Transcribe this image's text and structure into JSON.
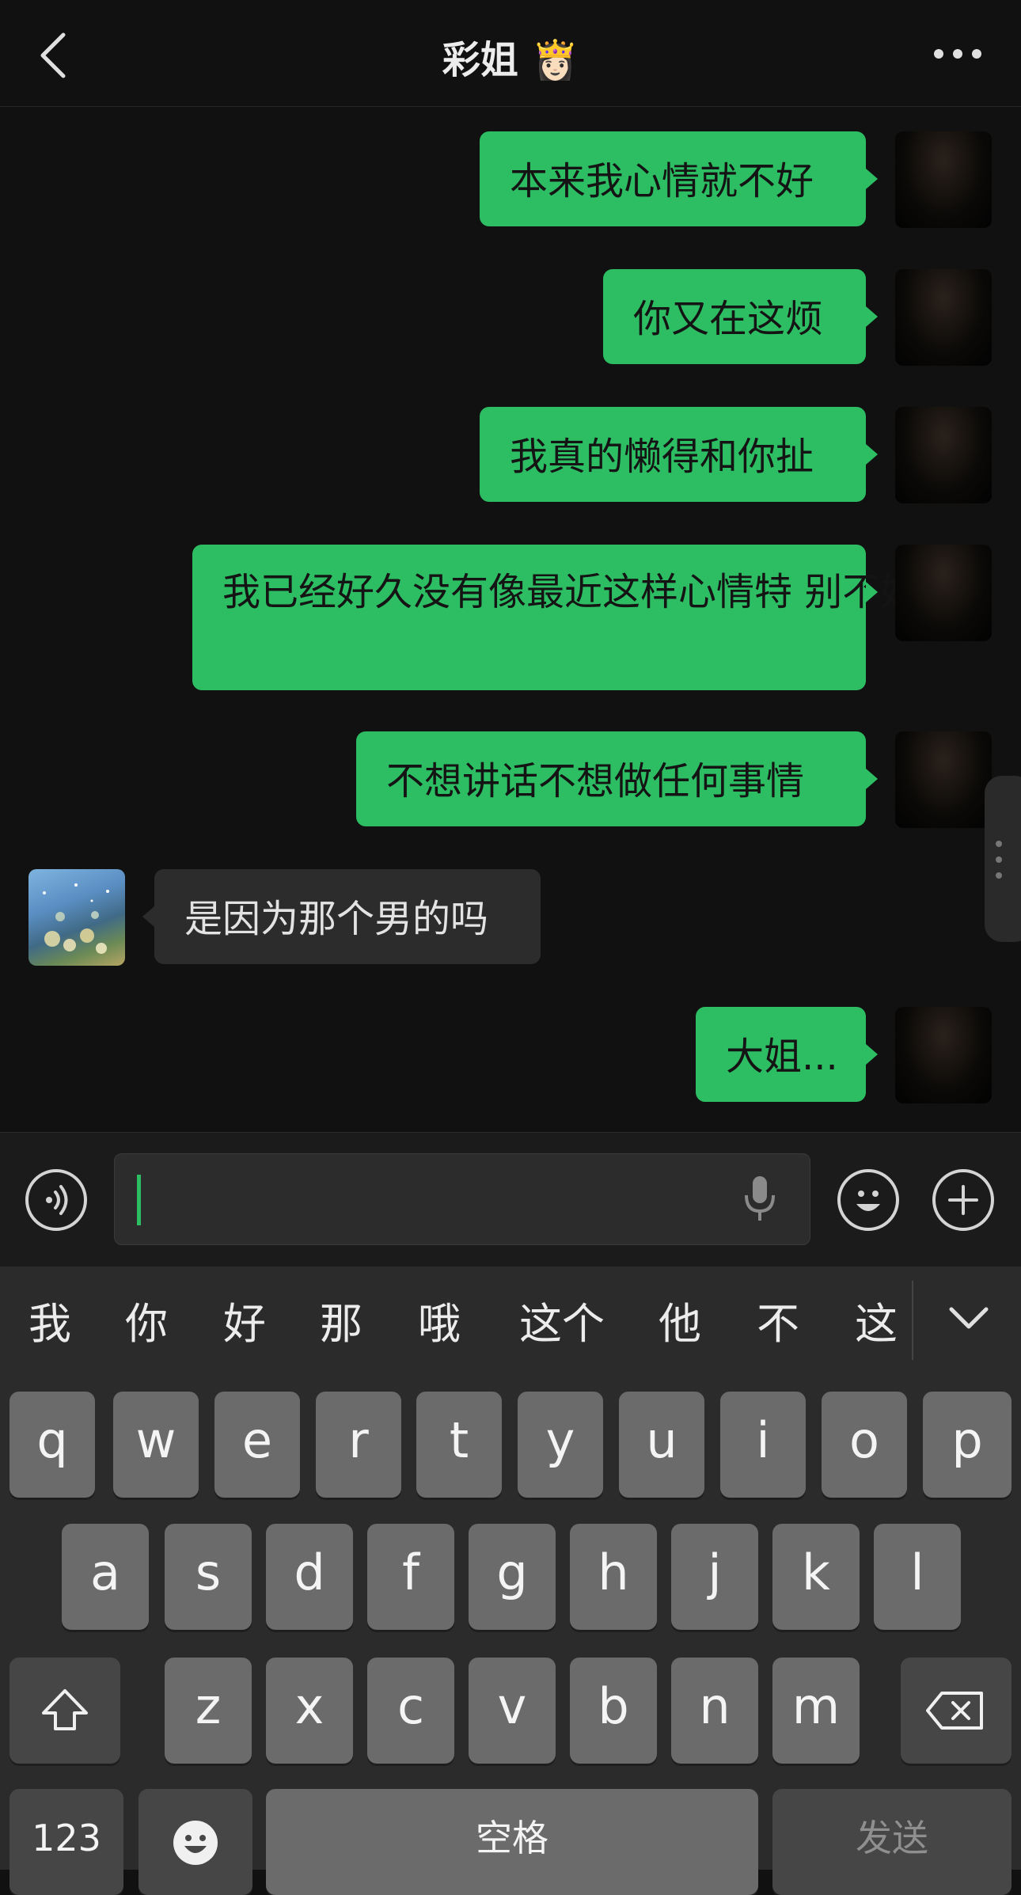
{
  "header": {
    "title": "彩姐 👸🏻"
  },
  "messages": [
    {
      "side": "me",
      "text": "本来我心情就不好"
    },
    {
      "side": "me",
      "text": "你又在这烦"
    },
    {
      "side": "me",
      "text": "我真的懒得和你扯"
    },
    {
      "side": "me",
      "text_line1": "我已经好久没有像最近这样心情特",
      "text_line2": "别不好了"
    },
    {
      "side": "me",
      "text": "不想讲话不想做任何事情"
    },
    {
      "side": "them",
      "text": "是因为那个男的吗"
    },
    {
      "side": "me",
      "text": "大姐..."
    }
  ],
  "input": {
    "voice_icon": "voice-wave-icon",
    "mic_icon": "microphone-icon",
    "emoji_icon": "smiley-icon",
    "plus_icon": "plus-icon",
    "value": ""
  },
  "keyboard": {
    "candidates": [
      "我",
      "你",
      "好",
      "那",
      "哦",
      "这个",
      "他",
      "不",
      "这"
    ],
    "row1": [
      "q",
      "w",
      "e",
      "r",
      "t",
      "y",
      "u",
      "i",
      "o",
      "p"
    ],
    "row2": [
      "a",
      "s",
      "d",
      "f",
      "g",
      "h",
      "j",
      "k",
      "l"
    ],
    "row3": [
      "z",
      "x",
      "c",
      "v",
      "b",
      "n",
      "m"
    ],
    "num_label": "123",
    "space_label": "空格",
    "send_label": "发送"
  },
  "colors": {
    "background": "#111111",
    "bubble_me": "#2dbe64",
    "bubble_them": "#2c2c2c",
    "keyboard_bg": "#2b2b2b",
    "key_bg": "#6b6b6b"
  }
}
